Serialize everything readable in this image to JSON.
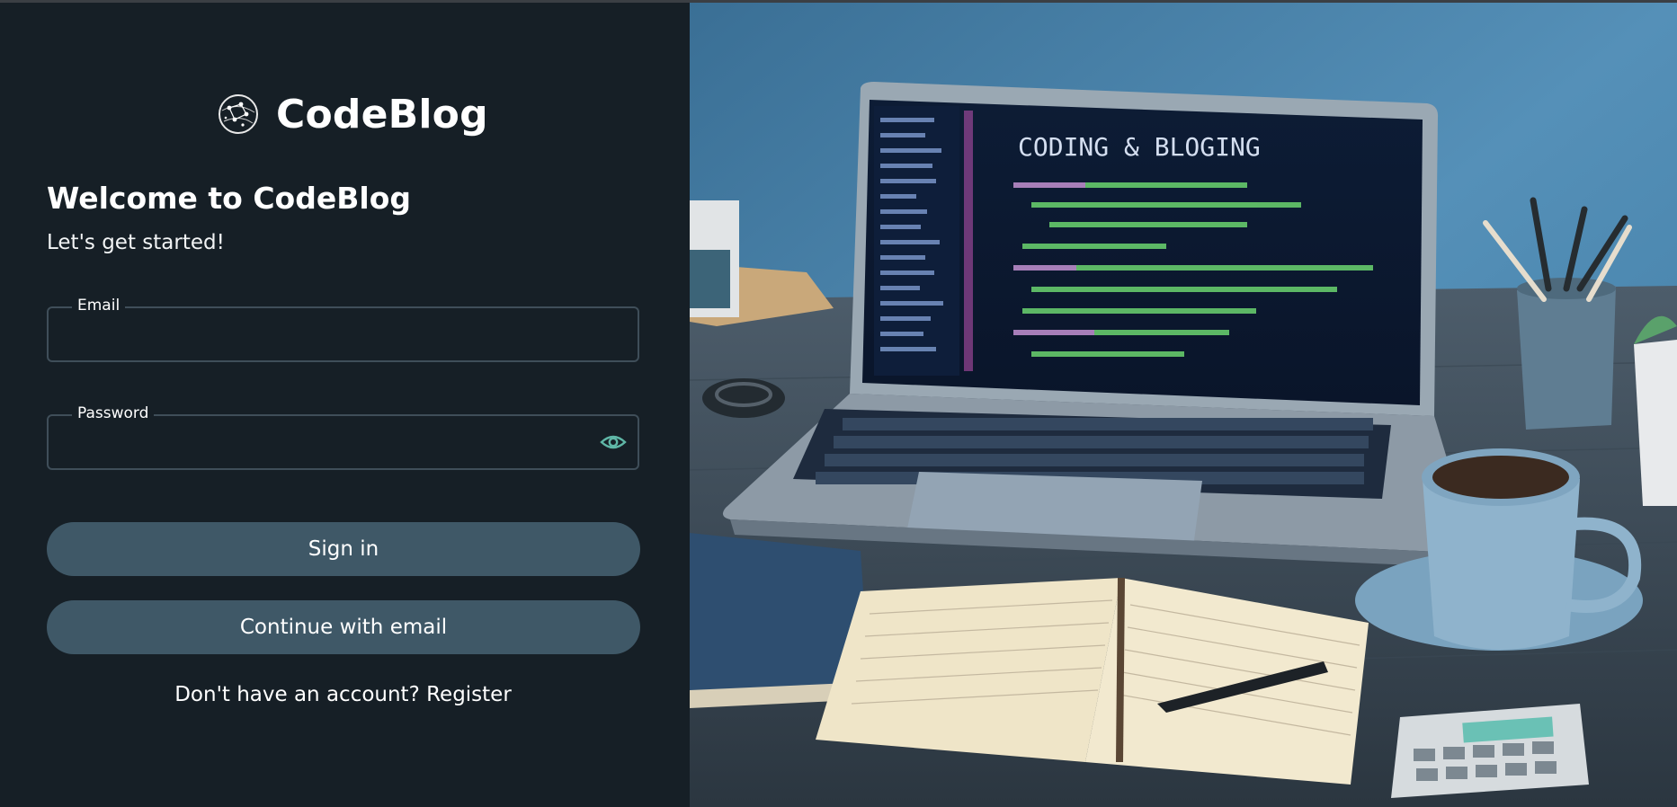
{
  "brand": {
    "name": "CodeBlog",
    "logo": "constellation-globe-icon"
  },
  "welcome": {
    "title": "Welcome to CodeBlog",
    "subtitle": "Let's get started!"
  },
  "form": {
    "email": {
      "label": "Email",
      "value": "",
      "placeholder": ""
    },
    "password": {
      "label": "Password",
      "value": "",
      "placeholder": "",
      "toggle_icon": "eye-icon"
    },
    "signin_label": "Sign in",
    "continue_label": "Continue with email"
  },
  "register": {
    "prompt": "Don't have an account?",
    "link": "Register"
  },
  "hero": {
    "screen_heading": "CODING & BLOGING",
    "description_icon": "laptop-notebook-coffee-illustration"
  },
  "colors": {
    "panel_bg": "#161f26",
    "button_bg": "#3f5867",
    "field_border": "#3f4e59",
    "eye_icon": "#5fb6a6"
  }
}
